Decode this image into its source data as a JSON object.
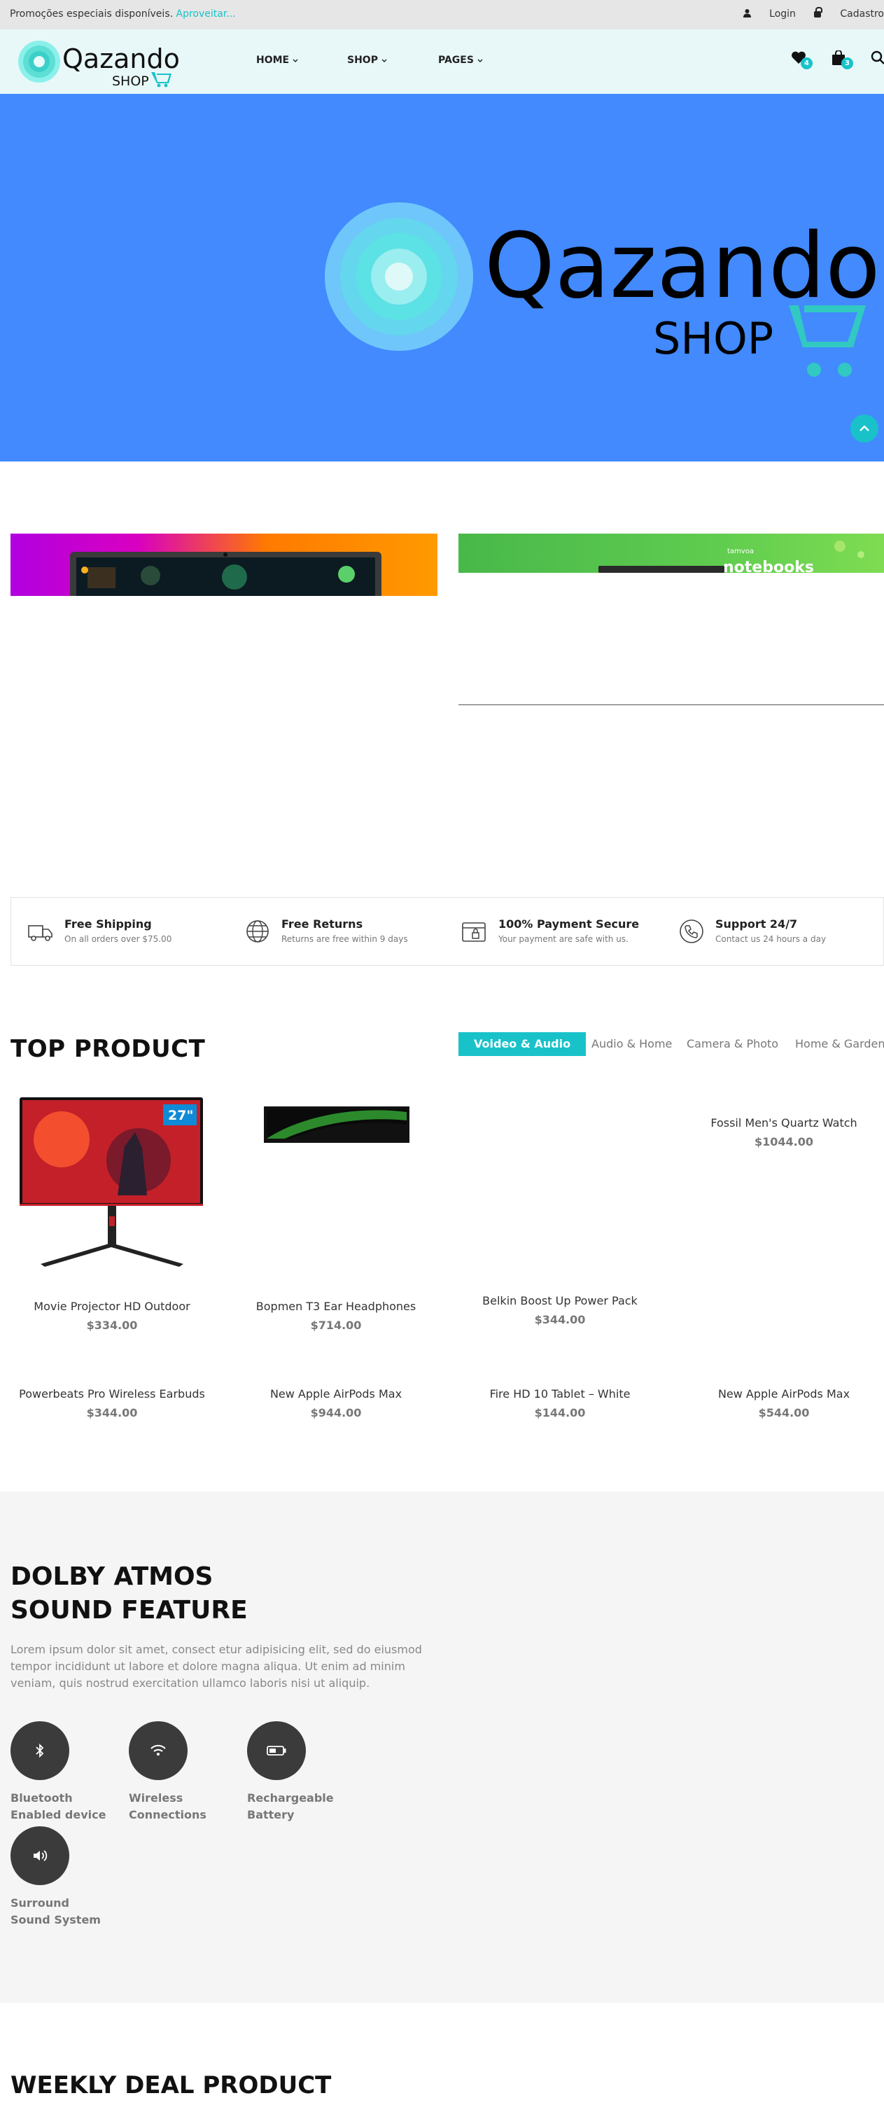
{
  "topbar": {
    "promo_text": "Promoções especiais disponíveis.",
    "promo_link": "Aproveitar...",
    "login": "Login",
    "register": "Cadastro"
  },
  "header": {
    "logo_word": "Qazando",
    "logo_sub": "SHOP",
    "nav": [
      {
        "label": "HOME"
      },
      {
        "label": "SHOP"
      },
      {
        "label": "PAGES"
      }
    ],
    "wishlist_count": "4",
    "cart_count": "3",
    "icons": [
      "heart-icon",
      "bag-icon",
      "search-icon"
    ]
  },
  "hero": {
    "logo_word": "Qazando",
    "logo_sub": "SHOP"
  },
  "banners": {
    "right_brand": "tamvoa",
    "right_title": "notebooks"
  },
  "features": [
    {
      "icon": "truck-icon",
      "title": "Free Shipping",
      "subtitle": "On all orders over $75.00"
    },
    {
      "icon": "globe-icon",
      "title": "Free Returns",
      "subtitle": "Returns are free within 9 days"
    },
    {
      "icon": "secure-payment-icon",
      "title": "100% Payment Secure",
      "subtitle": "Your payment are safe with us."
    },
    {
      "icon": "phone-support-icon",
      "title": "Support 24/7",
      "subtitle": "Contact us 24 hours a day"
    }
  ],
  "top_product": {
    "title": "TOP PRODUCT",
    "tabs": [
      "Voideo & Audio",
      "Audio & Home",
      "Camera & Photo",
      "Home & Garden"
    ],
    "monitor_badge": "27\"",
    "products": [
      {
        "name": "Movie Projector HD Outdoor",
        "price": "$334.00"
      },
      {
        "name": "Bopmen T3 Ear Headphones",
        "price": "$714.00"
      },
      {
        "name": "Belkin Boost Up Power Pack",
        "price": "$344.00"
      },
      {
        "name": "Fossil Men's Quartz Watch",
        "price": "$1044.00"
      },
      {
        "name": "Powerbeats Pro Wireless Earbuds",
        "price": "$344.00"
      },
      {
        "name": "New Apple AirPods Max",
        "price": "$944.00"
      },
      {
        "name": "Fire HD 10 Tablet – White",
        "price": "$144.00"
      },
      {
        "name": "New Apple AirPods Max",
        "price": "$544.00"
      }
    ]
  },
  "dolby": {
    "title_line1": "DOLBY ATMOS",
    "title_line2": "SOUND FEATURE",
    "text": "Lorem ipsum dolor sit amet, consect etur adipisicing elit, sed do eiusmod tempor incididunt ut labore et dolore magna aliqua. Ut enim ad minim veniam, quis nostrud exercitation ullamco laboris nisi ut aliquip.",
    "features": [
      {
        "icon": "bluetooth-icon",
        "line1": "Bluetooth",
        "line2": "Enabled device"
      },
      {
        "icon": "wifi-icon",
        "line1": "Wireless",
        "line2": "Connections"
      },
      {
        "icon": "battery-icon",
        "line1": "Rechargeable",
        "line2": "Battery"
      },
      {
        "icon": "speaker-icon",
        "line1": "Surround",
        "line2": "Sound System"
      }
    ]
  },
  "weekly": {
    "title": "WEEKLY DEAL PRODUCT"
  },
  "colors": {
    "accent": "#19c2c9",
    "hero_bg": "#428afe",
    "header_bg": "#e8f8f9",
    "topbar_bg": "#e6e6e6"
  }
}
